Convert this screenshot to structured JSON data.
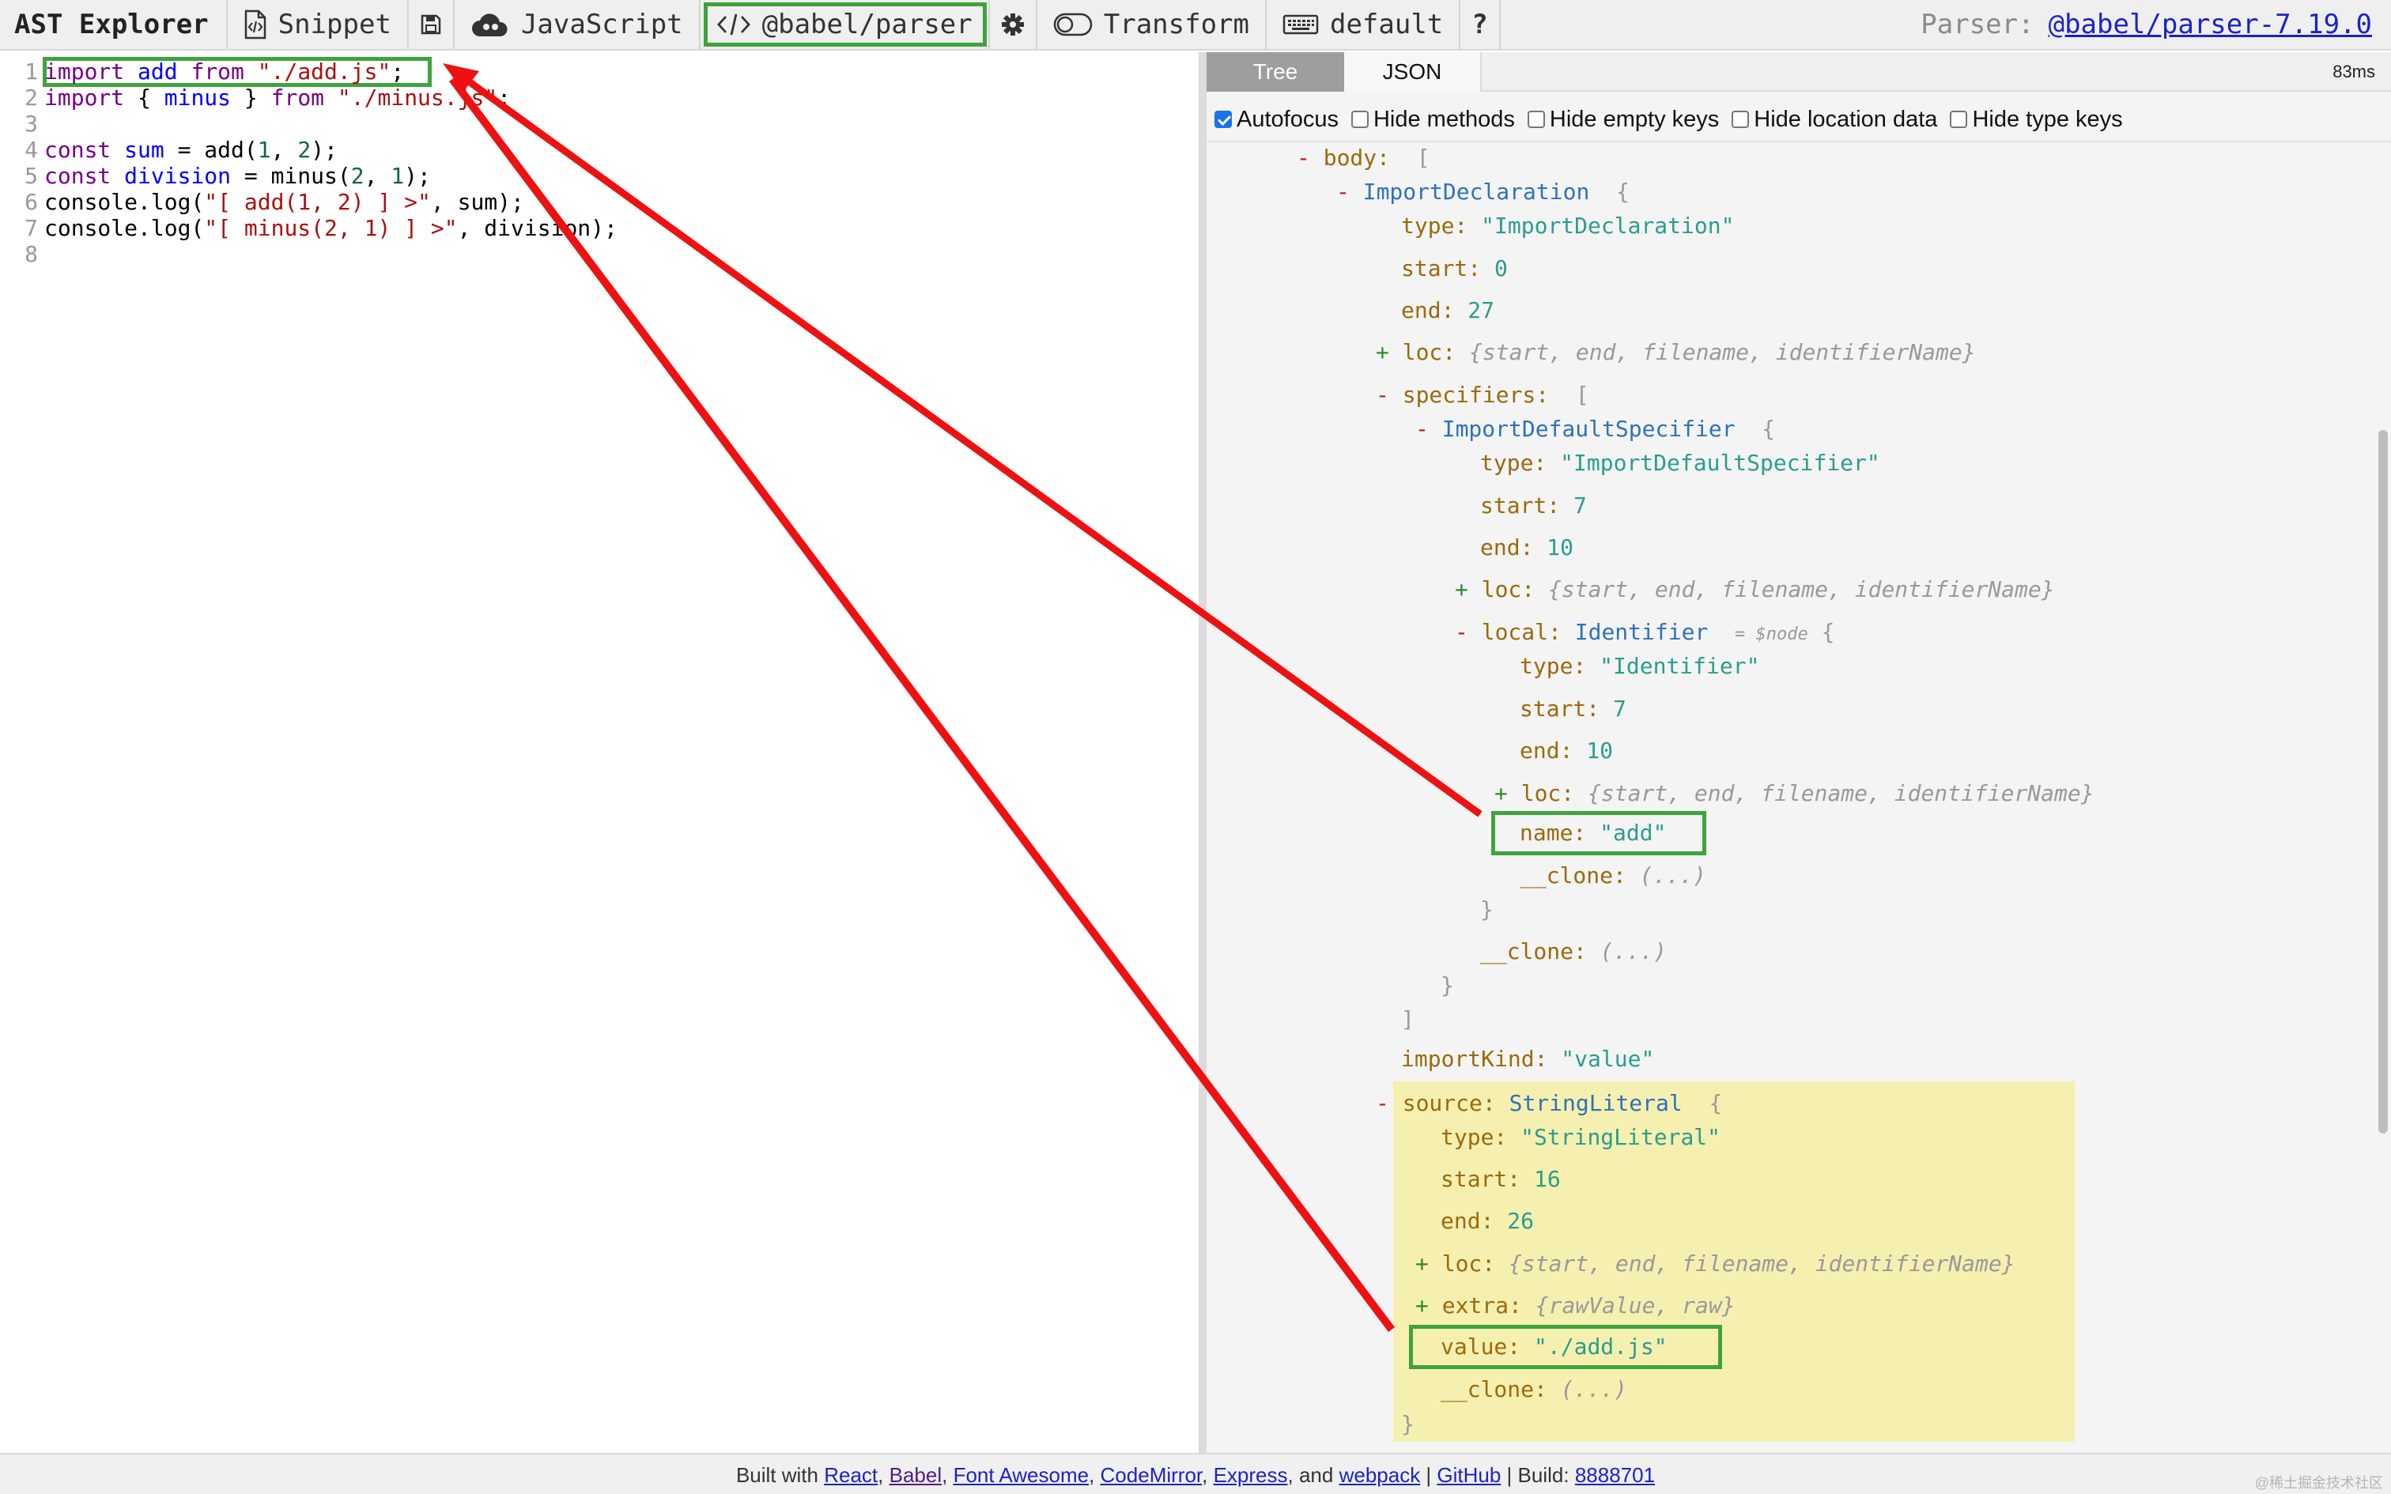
{
  "toolbar": {
    "brand": "AST Explorer",
    "snippet_label": "Snippet",
    "language_label": "JavaScript",
    "parser_label": "@babel/parser",
    "transform_label": "Transform",
    "keymap_label": "default",
    "help_label": "?",
    "parser_info_prefix": "Parser:",
    "parser_version_link": "@babel/parser-7.19.0"
  },
  "editor": {
    "lines": [
      {
        "num": "1",
        "tokens": [
          {
            "c": "kw",
            "t": "import"
          },
          {
            "c": "vr",
            "t": " "
          },
          {
            "c": "df",
            "t": "add"
          },
          {
            "c": "vr",
            "t": " "
          },
          {
            "c": "kw",
            "t": "from"
          },
          {
            "c": "vr",
            "t": " "
          },
          {
            "c": "st",
            "t": "\"./add.js\""
          },
          {
            "c": "vr",
            "t": ";"
          }
        ]
      },
      {
        "num": "2",
        "tokens": [
          {
            "c": "kw",
            "t": "import"
          },
          {
            "c": "vr",
            "t": " { "
          },
          {
            "c": "df",
            "t": "minus"
          },
          {
            "c": "vr",
            "t": " } "
          },
          {
            "c": "kw",
            "t": "from"
          },
          {
            "c": "vr",
            "t": " "
          },
          {
            "c": "st",
            "t": "\"./minus.js\""
          },
          {
            "c": "vr",
            "t": ";"
          }
        ]
      },
      {
        "num": "3",
        "tokens": []
      },
      {
        "num": "4",
        "tokens": [
          {
            "c": "kw",
            "t": "const"
          },
          {
            "c": "vr",
            "t": " "
          },
          {
            "c": "df",
            "t": "sum"
          },
          {
            "c": "vr",
            "t": " = add("
          },
          {
            "c": "nm",
            "t": "1"
          },
          {
            "c": "vr",
            "t": ", "
          },
          {
            "c": "nm",
            "t": "2"
          },
          {
            "c": "vr",
            "t": ");"
          }
        ]
      },
      {
        "num": "5",
        "tokens": [
          {
            "c": "kw",
            "t": "const"
          },
          {
            "c": "vr",
            "t": " "
          },
          {
            "c": "df",
            "t": "division"
          },
          {
            "c": "vr",
            "t": " = minus("
          },
          {
            "c": "nm",
            "t": "2"
          },
          {
            "c": "vr",
            "t": ", "
          },
          {
            "c": "nm",
            "t": "1"
          },
          {
            "c": "vr",
            "t": ");"
          }
        ]
      },
      {
        "num": "6",
        "tokens": [
          {
            "c": "vr",
            "t": "console.log("
          },
          {
            "c": "st",
            "t": "\"[ add(1, 2) ] >\""
          },
          {
            "c": "vr",
            "t": ", sum);"
          }
        ]
      },
      {
        "num": "7",
        "tokens": [
          {
            "c": "vr",
            "t": "console.log("
          },
          {
            "c": "st",
            "t": "\"[ minus(2, 1) ] >\""
          },
          {
            "c": "vr",
            "t": ", division);"
          }
        ]
      },
      {
        "num": "8",
        "tokens": []
      }
    ]
  },
  "panel": {
    "tab_tree": "Tree",
    "tab_json": "JSON",
    "timing": "83ms",
    "options": [
      {
        "label": "Autofocus",
        "checked": true
      },
      {
        "label": "Hide methods",
        "checked": false
      },
      {
        "label": "Hide empty keys",
        "checked": false
      },
      {
        "label": "Hide location data",
        "checked": false
      },
      {
        "label": "Hide type keys",
        "checked": false
      }
    ],
    "tree": {
      "body_key": "body:",
      "import_decl": "ImportDeclaration",
      "type_key": "type:",
      "start_key": "start:",
      "end_key": "end:",
      "loc_key": "loc:",
      "specifiers_key": "specifiers:",
      "local_key": "local:",
      "name_key": "name:",
      "clone_key": "__clone:",
      "importkind_key": "importKind:",
      "source_key": "source:",
      "extra_key": "extra:",
      "value_key": "value:",
      "loc_summary": "{start, end, filename, identifierName}",
      "extra_summary": "{rawValue, raw}",
      "clone_summary": "(...)",
      "node_marker": "= $node",
      "decl_type": "\"ImportDeclaration\"",
      "decl_start": "0",
      "decl_end": "27",
      "spec_name": "ImportDefaultSpecifier",
      "spec_type": "\"ImportDefaultSpecifier\"",
      "spec_start": "7",
      "spec_end": "10",
      "ident_name": "Identifier",
      "ident_type": "\"Identifier\"",
      "ident_start": "7",
      "ident_end": "10",
      "ident_value": "\"add\"",
      "import_kind": "\"value\"",
      "src_name": "StringLiteral",
      "src_type": "\"StringLiteral\"",
      "src_start": "16",
      "src_end": "26",
      "src_value": "\"./add.js\""
    }
  },
  "footer": {
    "built_with": "Built with",
    "links": {
      "react": "React",
      "babel": "Babel",
      "font_awesome": "Font Awesome",
      "codemirror": "CodeMirror",
      "express": "Express",
      "webpack": "webpack",
      "github": "GitHub",
      "build_id": "8888701"
    },
    "and": "and",
    "build_label": "Build:",
    "watermark": "@稀土掘金技术社区"
  },
  "colors": {
    "highlight_green": "#3ea33e",
    "arrow_red": "#ee1111",
    "source_highlight": "#f6f0b0"
  }
}
